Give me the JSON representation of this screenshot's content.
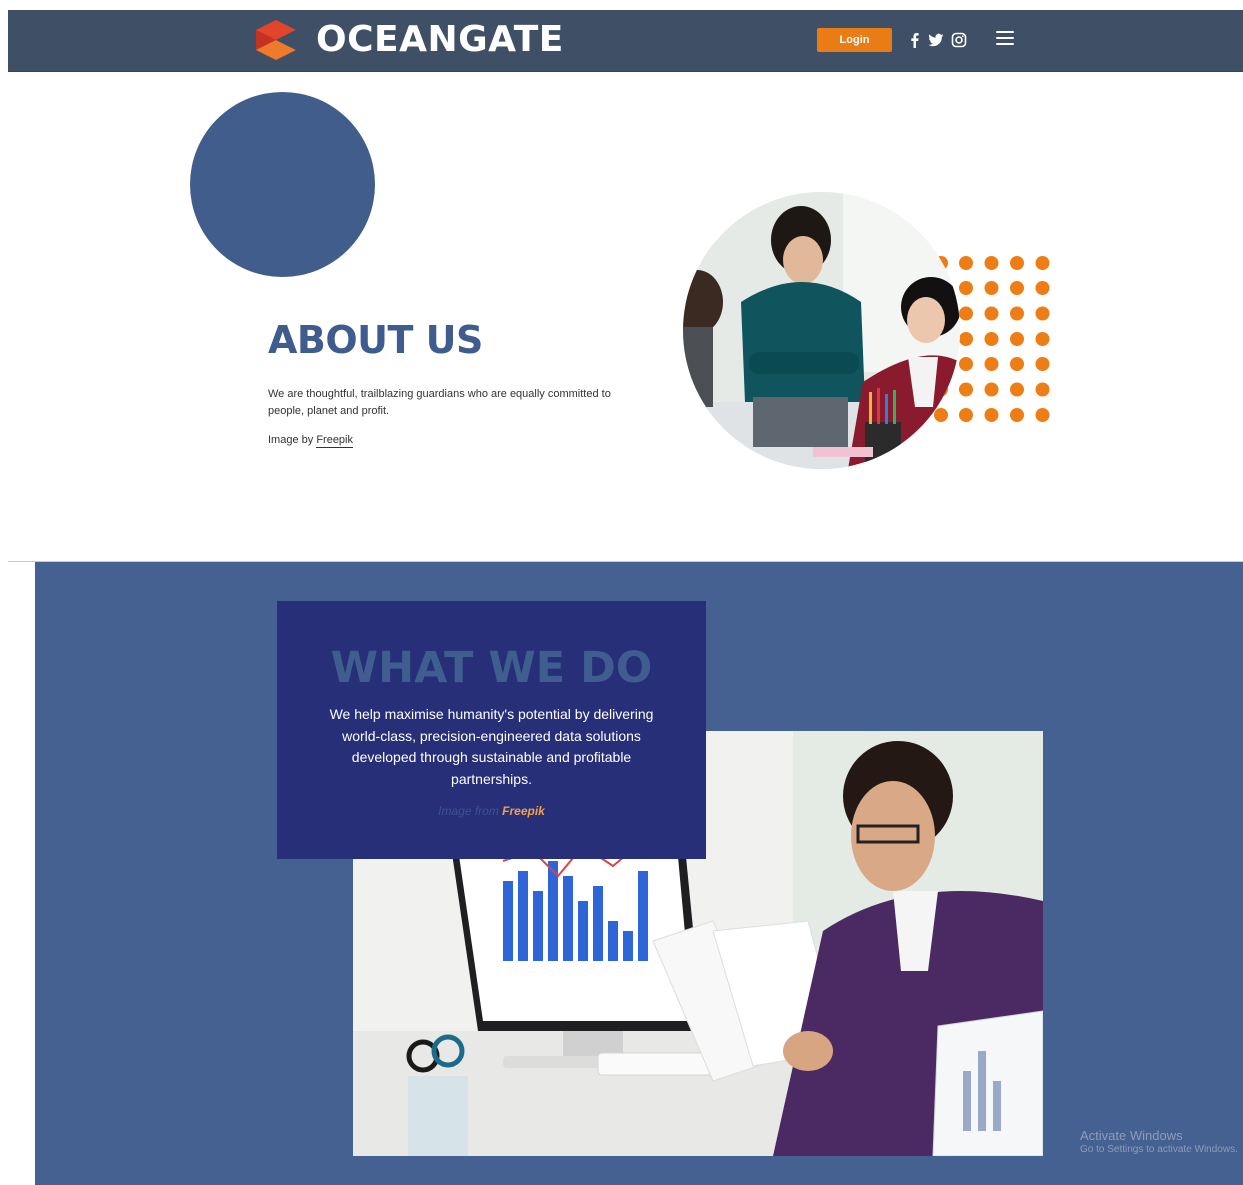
{
  "header": {
    "brand": "OCEANGATE",
    "login_label": "Login",
    "social_icons": [
      "facebook-icon",
      "twitter-icon",
      "instagram-icon"
    ],
    "menu_icon": "hamburger-menu-icon",
    "colors": {
      "bar": "#3f4f66",
      "accent": "#e97c14"
    }
  },
  "about": {
    "title": "ABOUT US",
    "text": "We are thoughtful, trailblazing guardians who are equally committed to people, planet and profit.",
    "credit_prefix": "Image by",
    "credit_link": "Freepik",
    "colors": {
      "circle": "#415d8c",
      "title": "#3f5c8e",
      "dots": "#ee7d15"
    }
  },
  "what_we_do": {
    "title": "WHAT WE DO",
    "text": "We help maximise humanity's potential by delivering world-class, precision-engineered data solutions developed through sustainable and profitable partnerships.",
    "credit_prefix": "Image from",
    "credit_link": "Freepik",
    "colors": {
      "background": "#456191",
      "box": "#262f78",
      "credit_link": "#f0a04b"
    }
  },
  "os_watermark": {
    "title": "Activate Windows",
    "subtitle": "Go to Settings to activate Windows."
  }
}
